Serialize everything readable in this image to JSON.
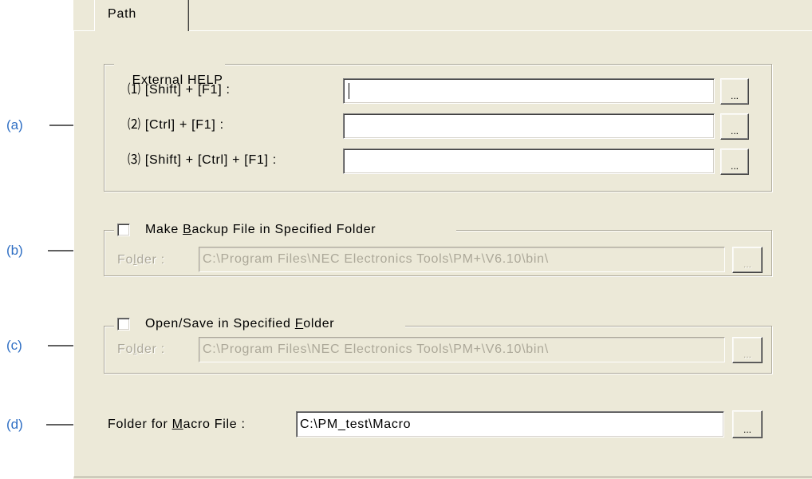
{
  "tab": {
    "label": "Path"
  },
  "annotations": [
    {
      "label": "(a)"
    },
    {
      "label": "(b)"
    },
    {
      "label": "(c)"
    },
    {
      "label": "(d)"
    }
  ],
  "external_help": {
    "title": "External HELP",
    "rows": [
      {
        "label": "⑴ [Shift] + [F1] :",
        "value": "",
        "browse_label": "..."
      },
      {
        "label": "⑵ [Ctrl] + [F1] :",
        "value": "",
        "browse_label": "..."
      },
      {
        "label": "⑶ [Shift] + [Ctrl] + [F1] :",
        "value": "",
        "browse_label": "..."
      }
    ]
  },
  "backup_folder": {
    "checkbox_label": {
      "before": "Make ",
      "mnemonic": "B",
      "after": "ackup File in Specified Folder"
    },
    "checked": false,
    "enabled": false,
    "folder_label": {
      "before": "Fo",
      "mnemonic": "l",
      "after": "der :"
    },
    "folder_value": "C:\\Program Files\\NEC Electronics Tools\\PM+\\V6.10\\bin\\",
    "browse_label": "..."
  },
  "open_save_folder": {
    "checkbox_label": {
      "before": "Open/Save in Specified ",
      "mnemonic": "F",
      "after": "older"
    },
    "checked": false,
    "enabled": false,
    "folder_label": {
      "before": "Fo",
      "mnemonic": "l",
      "after": "der :"
    },
    "folder_value": "C:\\Program Files\\NEC Electronics Tools\\PM+\\V6.10\\bin\\",
    "browse_label": "..."
  },
  "macro_folder": {
    "label": {
      "before": "Folder for ",
      "mnemonic": "M",
      "after": "acro File :"
    },
    "value": "C:\\PM_test\\Macro",
    "browse_label": "..."
  },
  "colors": {
    "dialog_background": "#ECE9D8",
    "annotation_text": "#2F6FC4",
    "disabled_text": "#ACA899"
  }
}
